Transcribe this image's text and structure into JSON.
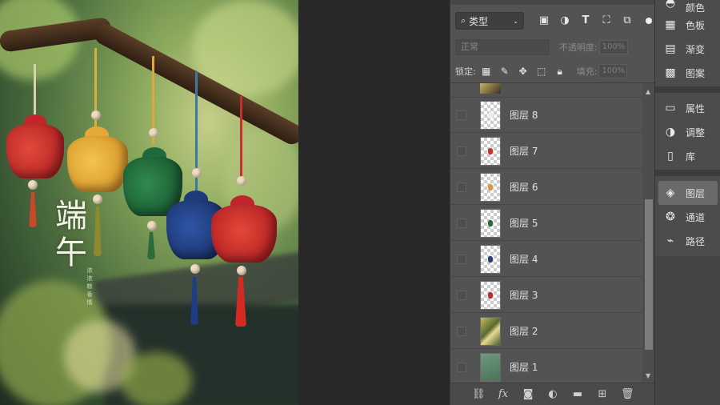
{
  "canvas": {
    "title_chars": [
      "端",
      "午"
    ],
    "subtitle": "浓浓粽香情"
  },
  "layers_panel": {
    "filter": {
      "kind_label": "类型",
      "icons": [
        "image-filter-icon",
        "adjustment-filter-icon",
        "type-filter-icon",
        "shape-filter-icon",
        "smart-object-filter-icon"
      ]
    },
    "blend_mode": "正常",
    "opacity_label": "不透明度:",
    "opacity_value": "100%",
    "lock_label": "锁定:",
    "fill_label": "填充:",
    "fill_value": "100%",
    "layers": [
      {
        "name": "图层 8",
        "swatch": "#ffffff"
      },
      {
        "name": "图层 7",
        "swatch": "#c2382d"
      },
      {
        "name": "图层 6",
        "swatch": "#d99b3a"
      },
      {
        "name": "图层 5",
        "swatch": "#2f6b38"
      },
      {
        "name": "图层 4",
        "swatch": "#2a3f73"
      },
      {
        "name": "图层 3",
        "swatch": "#b53030"
      },
      {
        "name": "图层 2",
        "swatch": "#9aa050"
      },
      {
        "name": "图层 1",
        "swatch": "#5e8a6a"
      }
    ],
    "footer_icons": [
      "link-layers-icon",
      "fx-icon",
      "add-mask-icon",
      "adjustment-layer-icon",
      "group-folder-icon",
      "new-layer-icon",
      "delete-layer-icon"
    ]
  },
  "dock": {
    "group1": [
      {
        "label": "颜色",
        "icon": "color-icon"
      },
      {
        "label": "色板",
        "icon": "swatches-icon"
      },
      {
        "label": "渐变",
        "icon": "gradient-icon"
      },
      {
        "label": "图案",
        "icon": "pattern-icon"
      }
    ],
    "group2": [
      {
        "label": "属性",
        "icon": "properties-icon"
      },
      {
        "label": "调整",
        "icon": "adjustments-icon"
      },
      {
        "label": "库",
        "icon": "libraries-icon"
      }
    ],
    "group3": [
      {
        "label": "图层",
        "icon": "layers-icon",
        "active": true
      },
      {
        "label": "通道",
        "icon": "channels-icon"
      },
      {
        "label": "路径",
        "icon": "paths-icon"
      }
    ]
  }
}
